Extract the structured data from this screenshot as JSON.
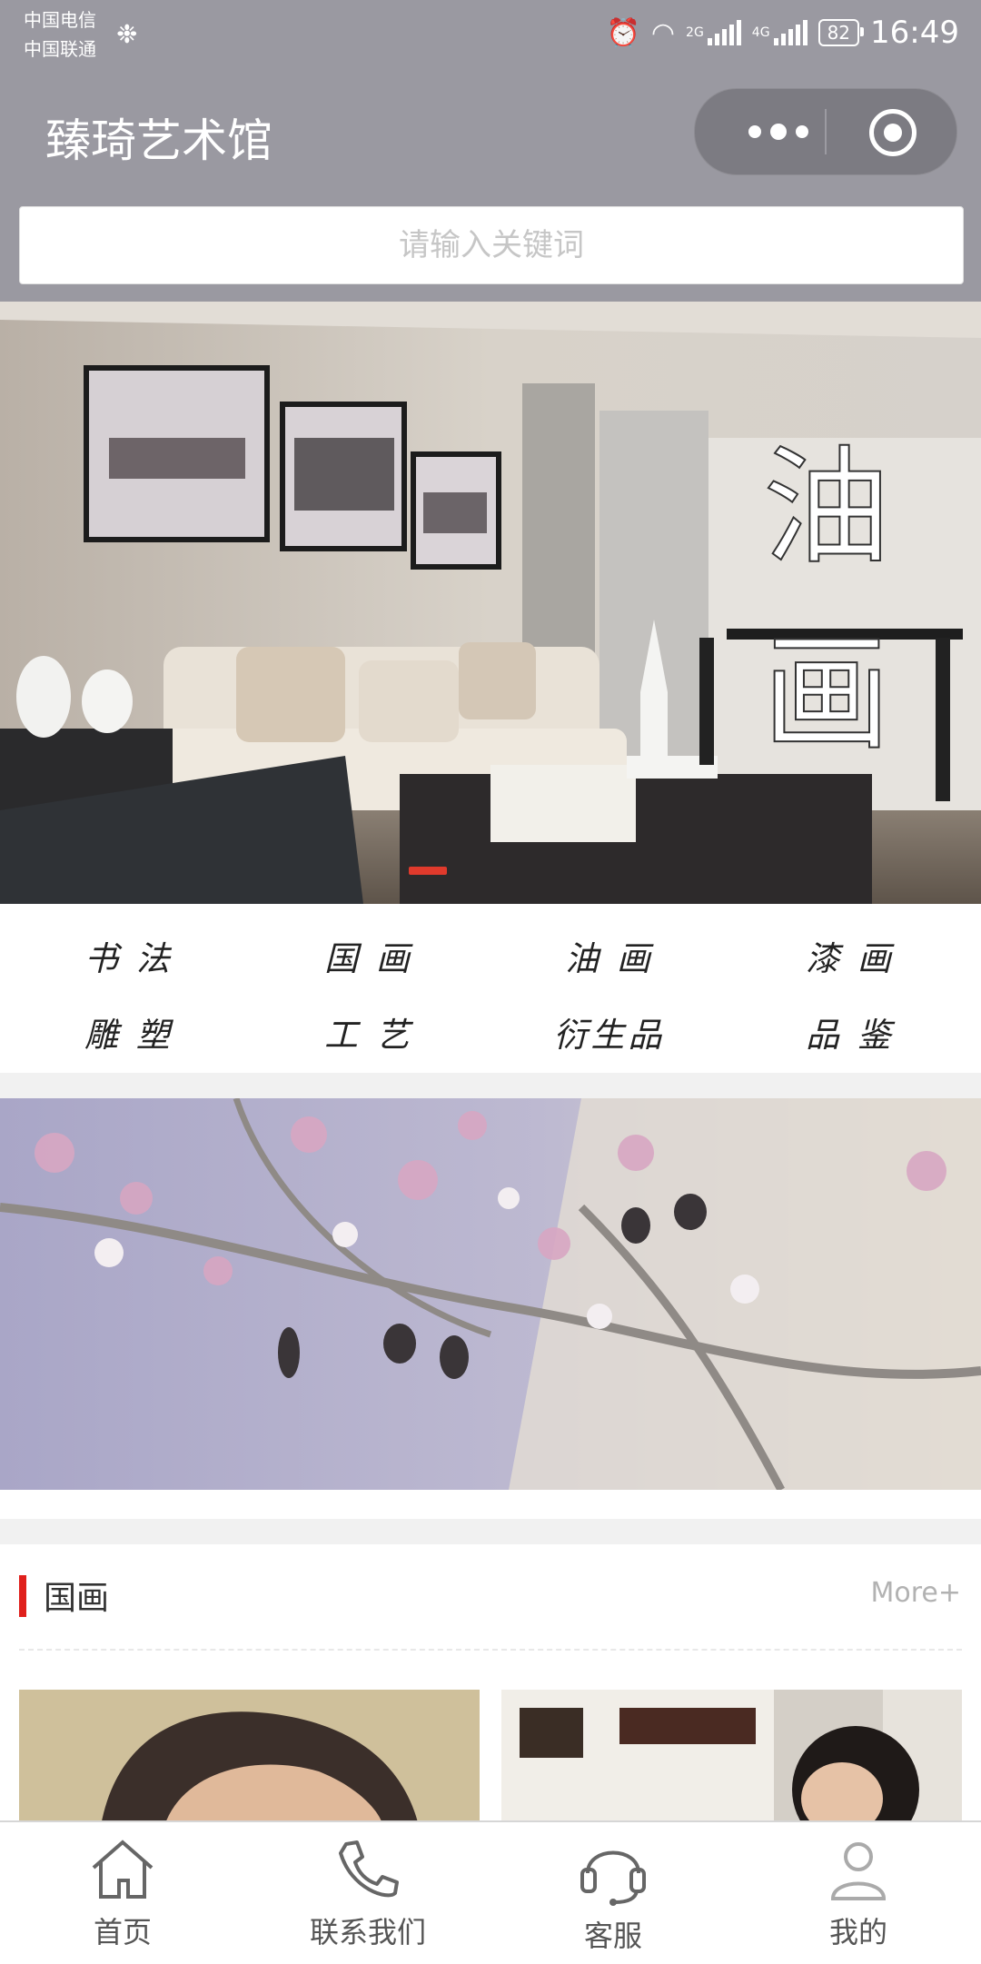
{
  "status_bar": {
    "carrier1": "中国电信",
    "carrier2": "中国联通",
    "net1": "2G",
    "net2": "4G",
    "battery": "82",
    "time": "16:49"
  },
  "nav": {
    "title": "臻琦艺术馆",
    "more_icon": "more-dots-icon",
    "close_icon": "target-circle-icon"
  },
  "search": {
    "placeholder": "请输入关键词"
  },
  "hero": {
    "overlay_text": "油画",
    "active_slide": 1
  },
  "categories": [
    {
      "label": "书 法"
    },
    {
      "label": "国 画"
    },
    {
      "label": "油 画"
    },
    {
      "label": "漆 画"
    },
    {
      "label": "雕 塑"
    },
    {
      "label": "工 艺"
    },
    {
      "label": "衍生品"
    },
    {
      "label": "品 鉴"
    }
  ],
  "section": {
    "title": "国画",
    "more": "More+"
  },
  "tabbar": [
    {
      "label": "首页",
      "icon": "home-icon"
    },
    {
      "label": "联系我们",
      "icon": "phone-icon"
    },
    {
      "label": "客服",
      "icon": "headset-icon"
    },
    {
      "label": "我的",
      "icon": "user-icon"
    }
  ],
  "colors": {
    "topbar": "#9a99a1",
    "accent": "#e0201c"
  }
}
